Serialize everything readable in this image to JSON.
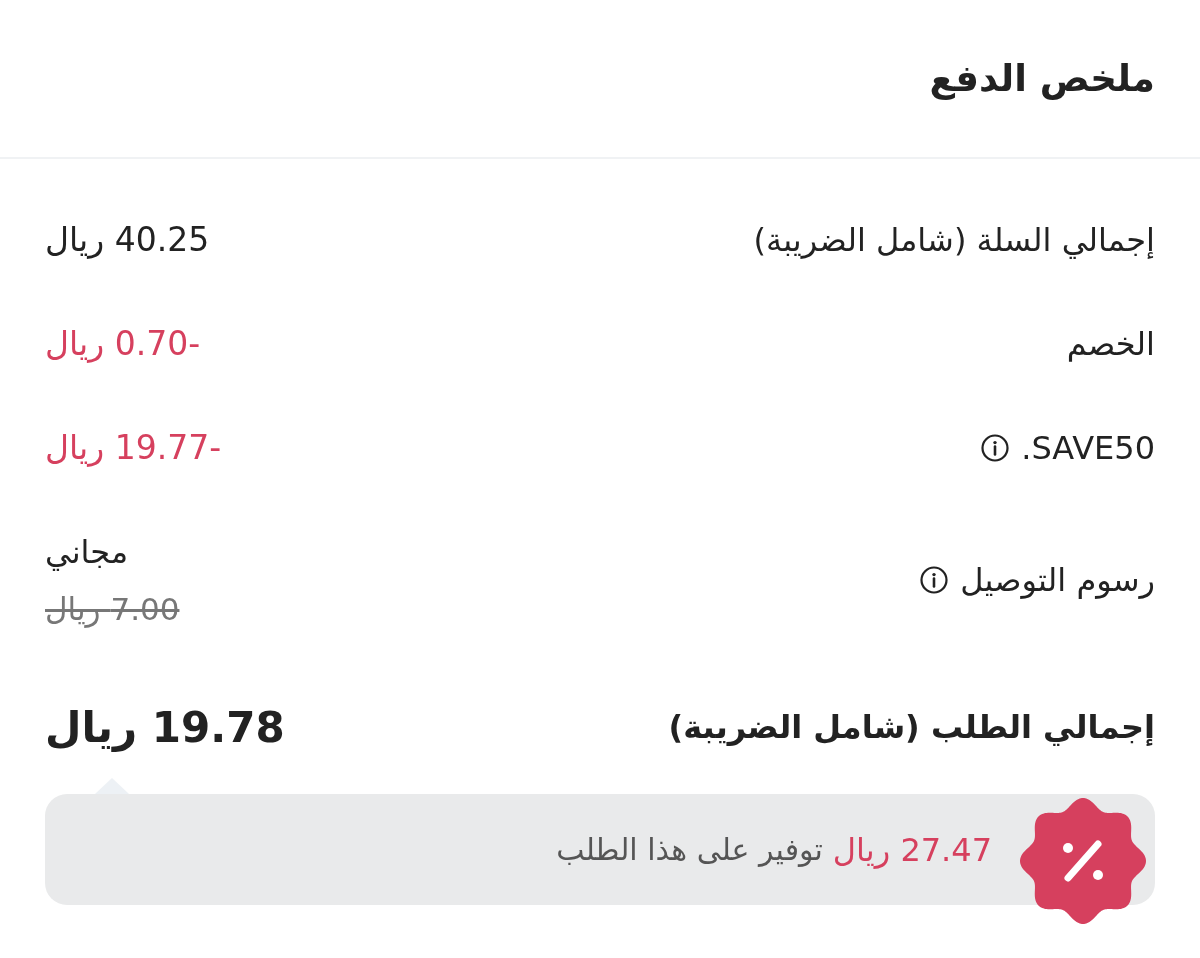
{
  "header": {
    "title": "ملخص الدفع"
  },
  "rows": [
    {
      "kind": "plain",
      "label": "إجمالي السلة (شامل الضريبة)",
      "info": false,
      "value": "40.25 ريال"
    },
    {
      "kind": "deduction",
      "label": "الخصم",
      "info": false,
      "value": "-0.70 ريال"
    },
    {
      "kind": "deduction",
      "label": "SAVE50.",
      "info": true,
      "value": "-19.77 ريال"
    },
    {
      "kind": "free",
      "label": "رسوم التوصيل",
      "info": true,
      "value": "مجاني",
      "original_value": "7.00 ريال"
    }
  ],
  "total": {
    "label": "إجمالي الطلب (شامل الضريبة)",
    "value": "19.78 ريال"
  },
  "savings": {
    "amount": "27.47 ريال",
    "text": "توفير على هذا الطلب"
  }
}
